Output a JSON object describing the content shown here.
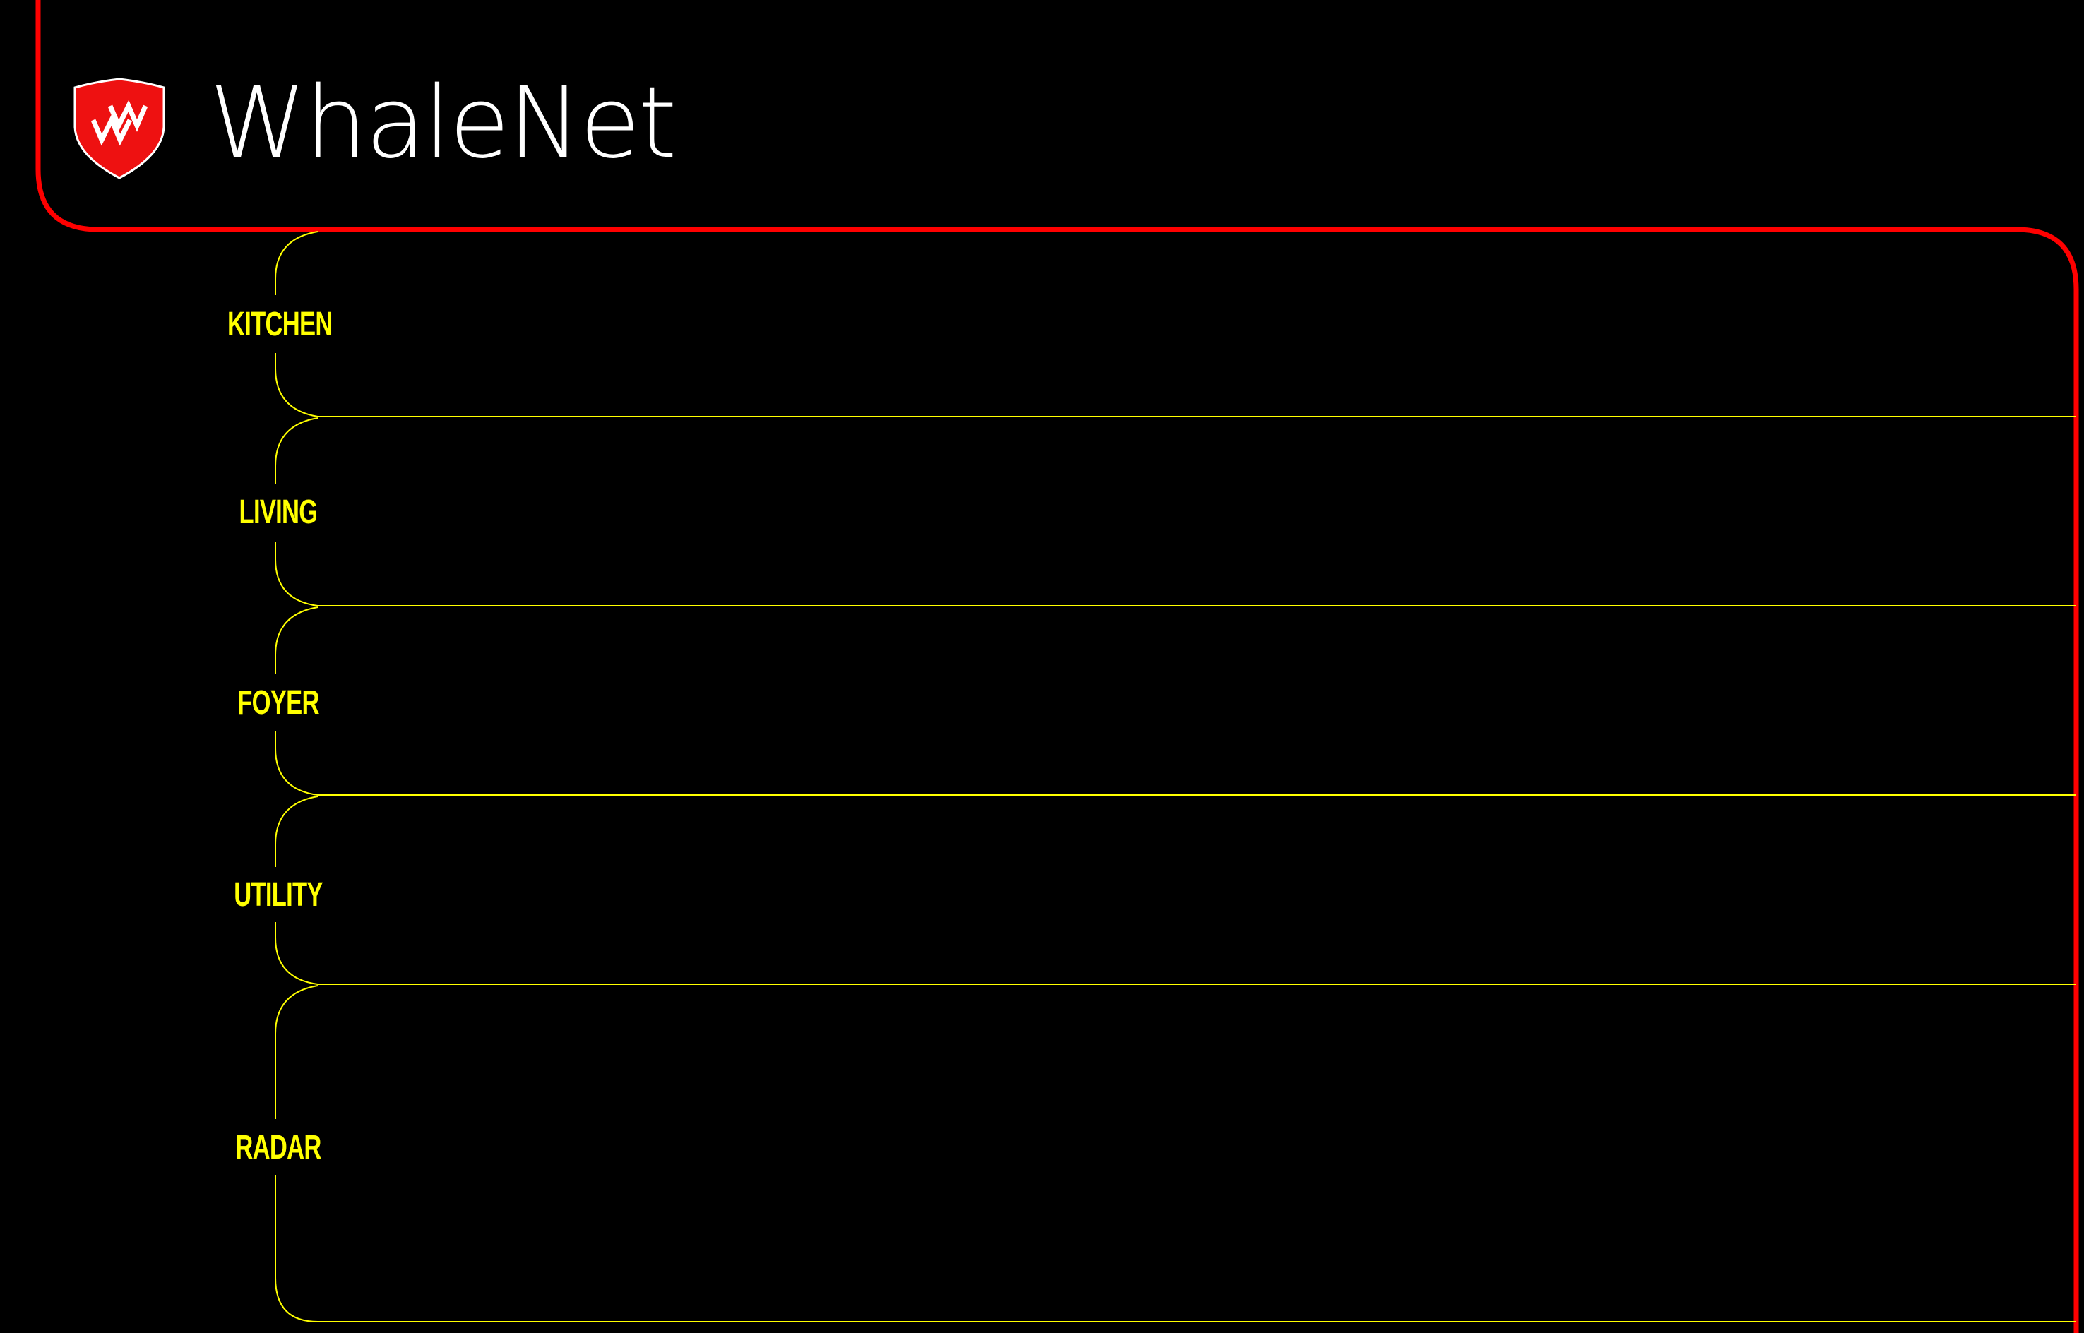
{
  "app": {
    "title": "WhaleNet",
    "logo_text": "WN",
    "logo_icon": "shield-logo-icon"
  },
  "colors": {
    "background": "#000000",
    "frame": "#ff0000",
    "room_outline": "#ffff00",
    "room_label": "#ffff00",
    "title": "#ffffff"
  },
  "rooms": [
    {
      "id": "kitchen",
      "label": "KITCHEN"
    },
    {
      "id": "living",
      "label": "LIVING"
    },
    {
      "id": "foyer",
      "label": "FOYER"
    },
    {
      "id": "utility",
      "label": "UTILITY"
    },
    {
      "id": "radar",
      "label": "RADAR"
    }
  ]
}
